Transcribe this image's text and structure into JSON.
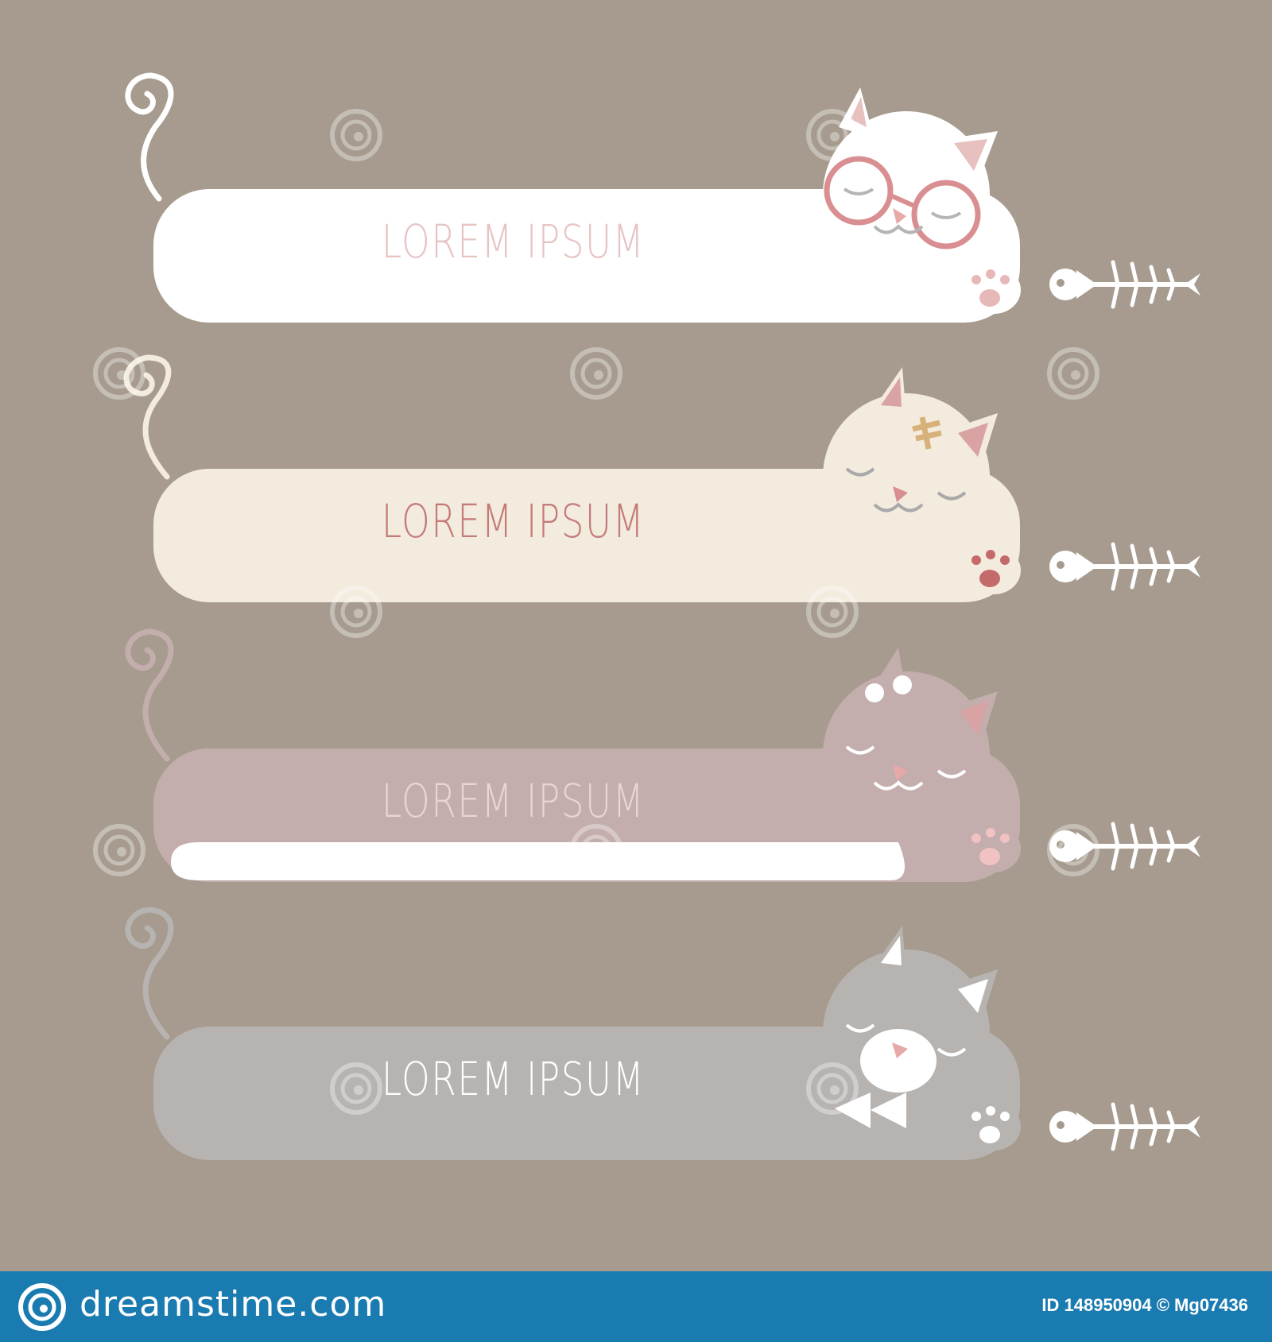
{
  "banners": [
    {
      "label": "LOREM IPSUM",
      "body_color": "#ffffff",
      "text_color": "#e7c4c4"
    },
    {
      "label": "LOREM IPSUM",
      "body_color": "#f3ebdd",
      "text_color": "#c47a7a"
    },
    {
      "label": "LOREM IPSUM",
      "body_color": "#c4adad",
      "text_color": "#e8d6d6"
    },
    {
      "label": "LOREM IPSUM",
      "body_color": "#b7b3b1",
      "text_color": "#ffffff"
    }
  ],
  "icons": [
    "spiral-tail-icon",
    "cat-head-icon",
    "paw-icon",
    "fish-bone-icon"
  ],
  "footer": {
    "brand": "dreamstime.com",
    "id_text": "ID 148950904 © Mg07436",
    "color": "#1a7bb1"
  },
  "background": "#a69b8e"
}
